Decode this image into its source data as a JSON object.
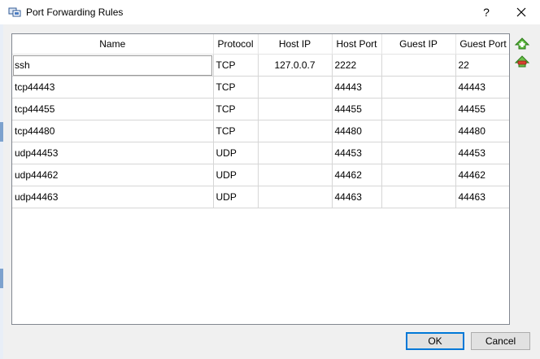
{
  "window": {
    "title": "Port Forwarding Rules",
    "help_label": "?"
  },
  "table": {
    "columns": [
      "Name",
      "Protocol",
      "Host IP",
      "Host Port",
      "Guest IP",
      "Guest Port"
    ],
    "rows": [
      [
        "ssh",
        "TCP",
        "127.0.0.7",
        "2222",
        "",
        "22"
      ],
      [
        "tcp44443",
        "TCP",
        "",
        "44443",
        "",
        "44443"
      ],
      [
        "tcp44455",
        "TCP",
        "",
        "44455",
        "",
        "44455"
      ],
      [
        "tcp44480",
        "TCP",
        "",
        "44480",
        "",
        "44480"
      ],
      [
        "udp44453",
        "UDP",
        "",
        "44453",
        "",
        "44453"
      ],
      [
        "udp44462",
        "UDP",
        "",
        "44462",
        "",
        "44462"
      ],
      [
        "udp44463",
        "UDP",
        "",
        "44463",
        "",
        "44463"
      ]
    ],
    "selected_row": 0
  },
  "side_buttons": {
    "add_icon": "add-rule-icon",
    "remove_icon": "remove-rule-icon"
  },
  "buttons": {
    "ok": "OK",
    "cancel": "Cancel"
  },
  "colors": {
    "accent": "#0078d7",
    "add_green": "#3a9a2a",
    "remove_red": "#c0392b"
  }
}
